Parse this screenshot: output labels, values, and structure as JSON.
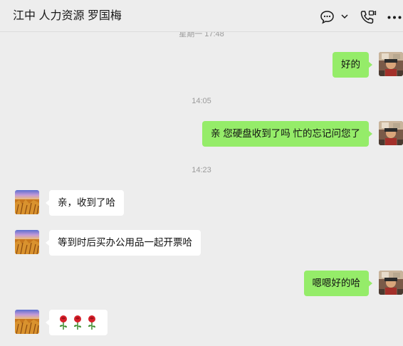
{
  "header": {
    "title": "江中 人力资源 罗国梅",
    "icons": [
      "chat-bubble-icon",
      "chevron-down-icon",
      "video-call-icon",
      "more-icon"
    ]
  },
  "timestamps": {
    "partial": "星期一 17:48",
    "t1": "14:05",
    "t2": "14:23"
  },
  "messages": [
    {
      "from": "me",
      "text": "好的"
    },
    {
      "from": "me",
      "text": "亲 您硬盘收到了吗 忙的忘记问您了"
    },
    {
      "from": "other",
      "text": "亲，收到了哈"
    },
    {
      "from": "other",
      "text": "等到时后买办公用品一起开票哈"
    },
    {
      "from": "me",
      "text": "嗯嗯好的哈"
    },
    {
      "from": "other",
      "emoji": [
        "rose",
        "rose",
        "rose"
      ]
    }
  ],
  "colors": {
    "background": "#ededed",
    "my_bubble": "#95ec69",
    "other_bubble": "#ffffff",
    "timestamp": "#9b9b9b"
  }
}
